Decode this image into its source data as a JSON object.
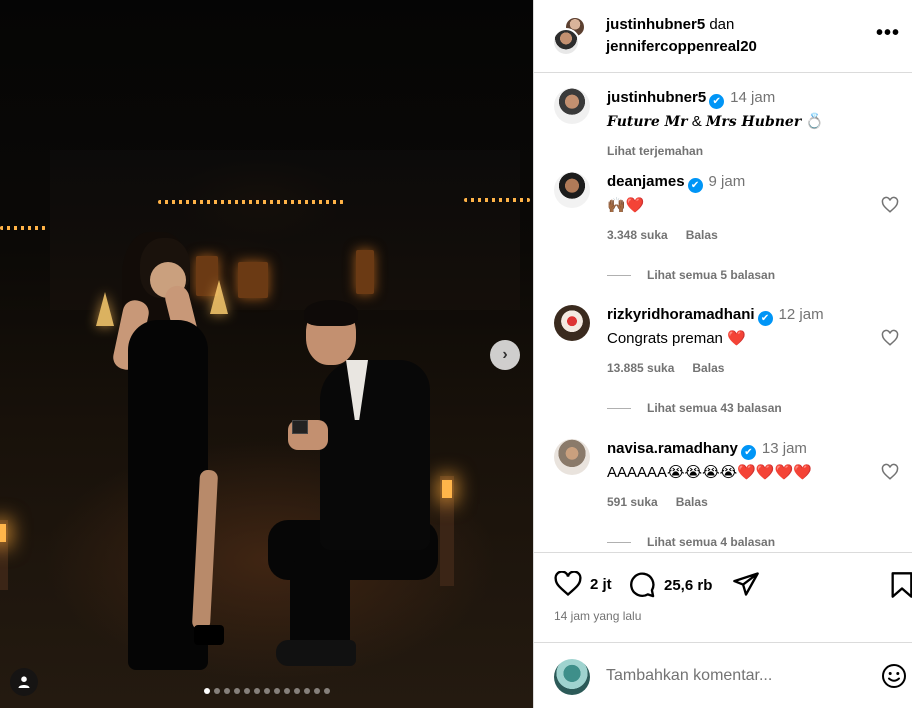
{
  "photo": {
    "carousel_total": 13,
    "carousel_active": 1,
    "next_label": "›"
  },
  "header": {
    "user1": "justinhubner5",
    "connector": "dan",
    "user2": "jennifercoppenreal20",
    "more_label": "•••"
  },
  "caption": {
    "username": "justinhubner5",
    "verified": "✔",
    "time": "14 jam",
    "text_part1": "Future Mr",
    "text_amp": " & ",
    "text_part2": "Mrs Hubner",
    "ring_emoji": "💍",
    "translate": "Lihat terjemahan"
  },
  "comments": [
    {
      "username": "deanjames",
      "verified": "✔",
      "time": "9 jam",
      "text": "🙌🏾❤️",
      "likes": "3.348 suka",
      "reply": "Balas",
      "view_replies": "Lihat semua 5 balasan"
    },
    {
      "username": "rizkyridhoramadhani",
      "verified": "✔",
      "time": "12 jam",
      "text": "Congrats preman ❤️",
      "likes": "13.885 suka",
      "reply": "Balas",
      "view_replies": "Lihat semua 43 balasan"
    },
    {
      "username": "navisa.ramadhany",
      "verified": "✔",
      "time": "13 jam",
      "text": "AAAAAA😭😭😭😭❤️❤️❤️❤️",
      "likes": "591 suka",
      "reply": "Balas",
      "view_replies": "Lihat semua 4 balasan"
    }
  ],
  "actions": {
    "likes_count": "2 jt",
    "comments_count": "25,6 rb",
    "posted_ago": "14 jam yang lalu"
  },
  "add_comment": {
    "placeholder": "Tambahkan komentar..."
  },
  "colors": {
    "verified": "#0095f6",
    "muted": "#737373",
    "border": "#dbdbdb"
  },
  "icons": [
    "heart-icon",
    "comment-icon",
    "share-icon",
    "bookmark-icon",
    "emoji-icon",
    "more-icon",
    "user-tag-icon",
    "chevron-right-icon",
    "verified-badge-icon"
  ]
}
